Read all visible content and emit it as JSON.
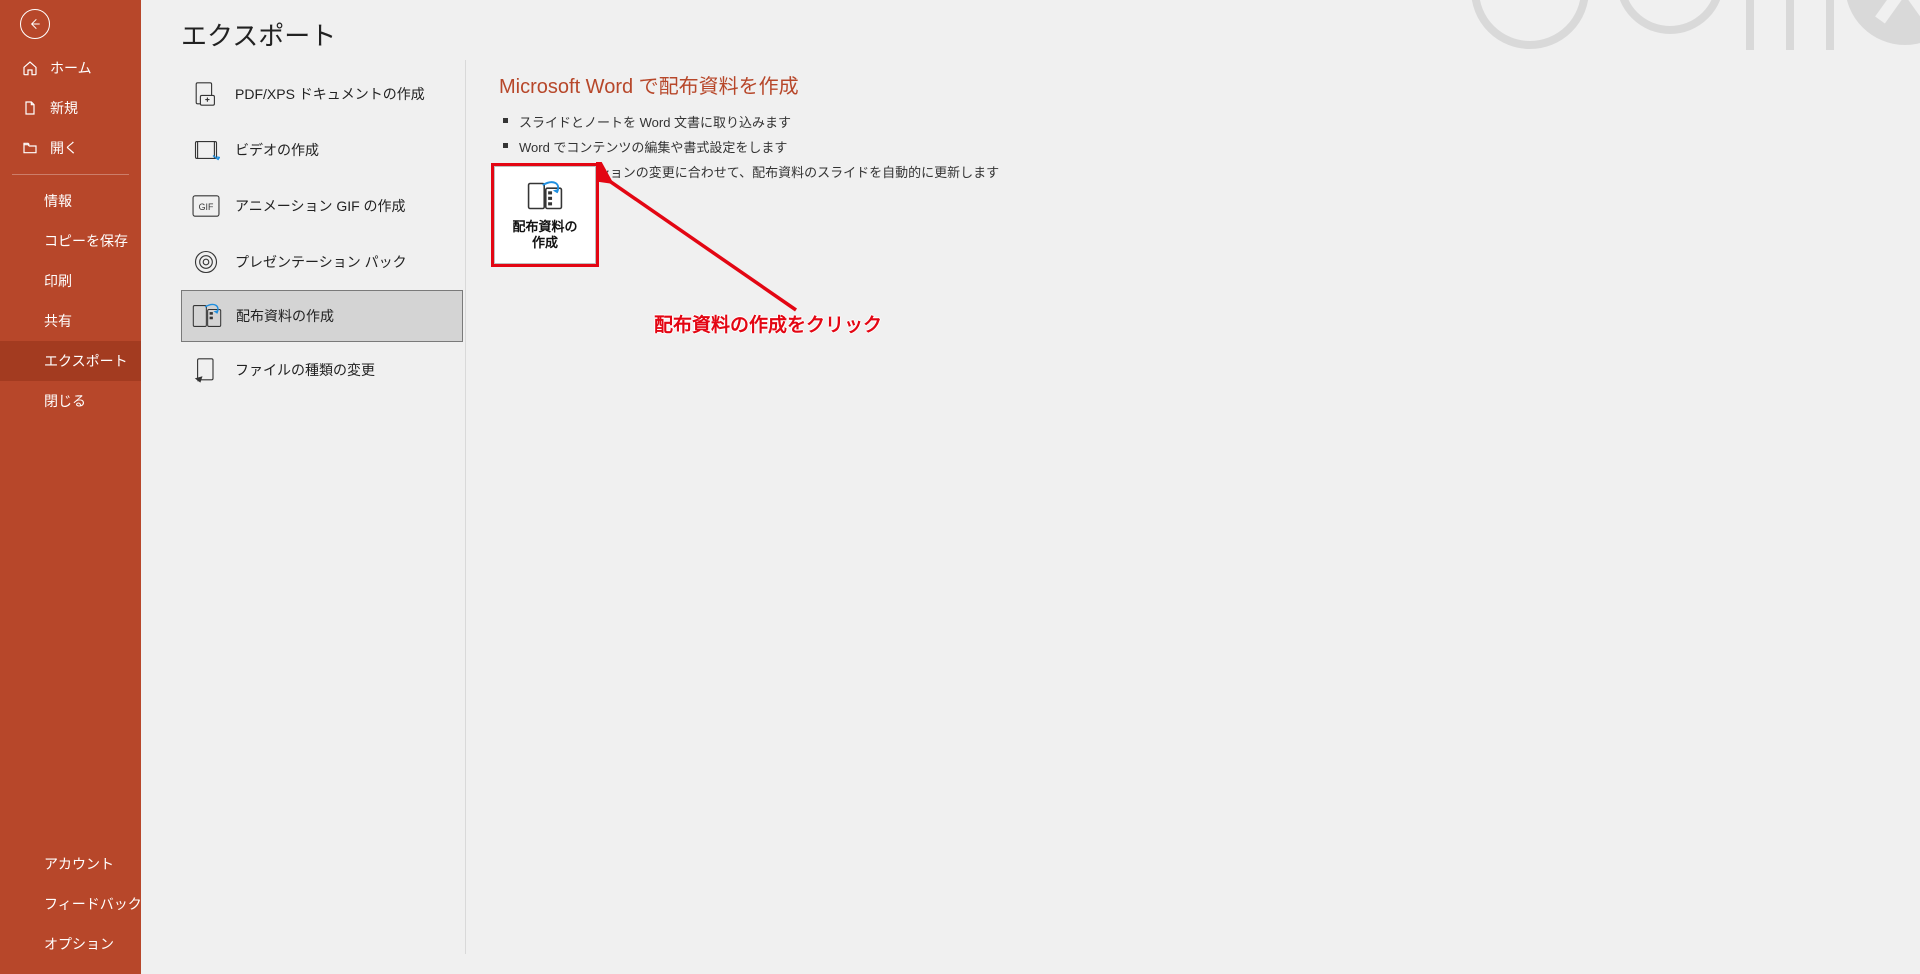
{
  "sidebar": {
    "top": [
      {
        "key": "home",
        "label": "ホーム",
        "icon": "home-icon"
      },
      {
        "key": "new",
        "label": "新規",
        "icon": "new-icon"
      },
      {
        "key": "open",
        "label": "開く",
        "icon": "open-icon"
      }
    ],
    "mid": [
      {
        "key": "info",
        "label": "情報"
      },
      {
        "key": "savecopy",
        "label": "コピーを保存"
      },
      {
        "key": "print",
        "label": "印刷"
      },
      {
        "key": "share",
        "label": "共有"
      },
      {
        "key": "export",
        "label": "エクスポート",
        "selected": true
      },
      {
        "key": "close",
        "label": "閉じる"
      }
    ],
    "bottom": [
      {
        "key": "account",
        "label": "アカウント"
      },
      {
        "key": "feedback",
        "label": "フィードバック"
      },
      {
        "key": "options",
        "label": "オプション"
      }
    ]
  },
  "page": {
    "title": "エクスポート"
  },
  "export_options": [
    {
      "key": "pdfxps",
      "label": "PDF/XPS ドキュメントの作成"
    },
    {
      "key": "video",
      "label": "ビデオの作成"
    },
    {
      "key": "gif",
      "label": "アニメーション GIF の作成"
    },
    {
      "key": "package",
      "label": "プレゼンテーション パック"
    },
    {
      "key": "handout",
      "label": "配布資料の作成",
      "selected": true
    },
    {
      "key": "changetype",
      "label": "ファイルの種類の変更"
    }
  ],
  "detail": {
    "title": "Microsoft Word で配布資料を作成",
    "bullets": [
      "スライドとノートを Word 文書に取り込みます",
      "Word でコンテンツの編集や書式設定をします",
      "プレゼンテーションの変更に合わせて、配布資料のスライドを自動的に更新します"
    ],
    "button_label_line1": "配布資料の",
    "button_label_line2": "作成"
  },
  "annotation": {
    "text": "配布資料の作成をクリック"
  }
}
